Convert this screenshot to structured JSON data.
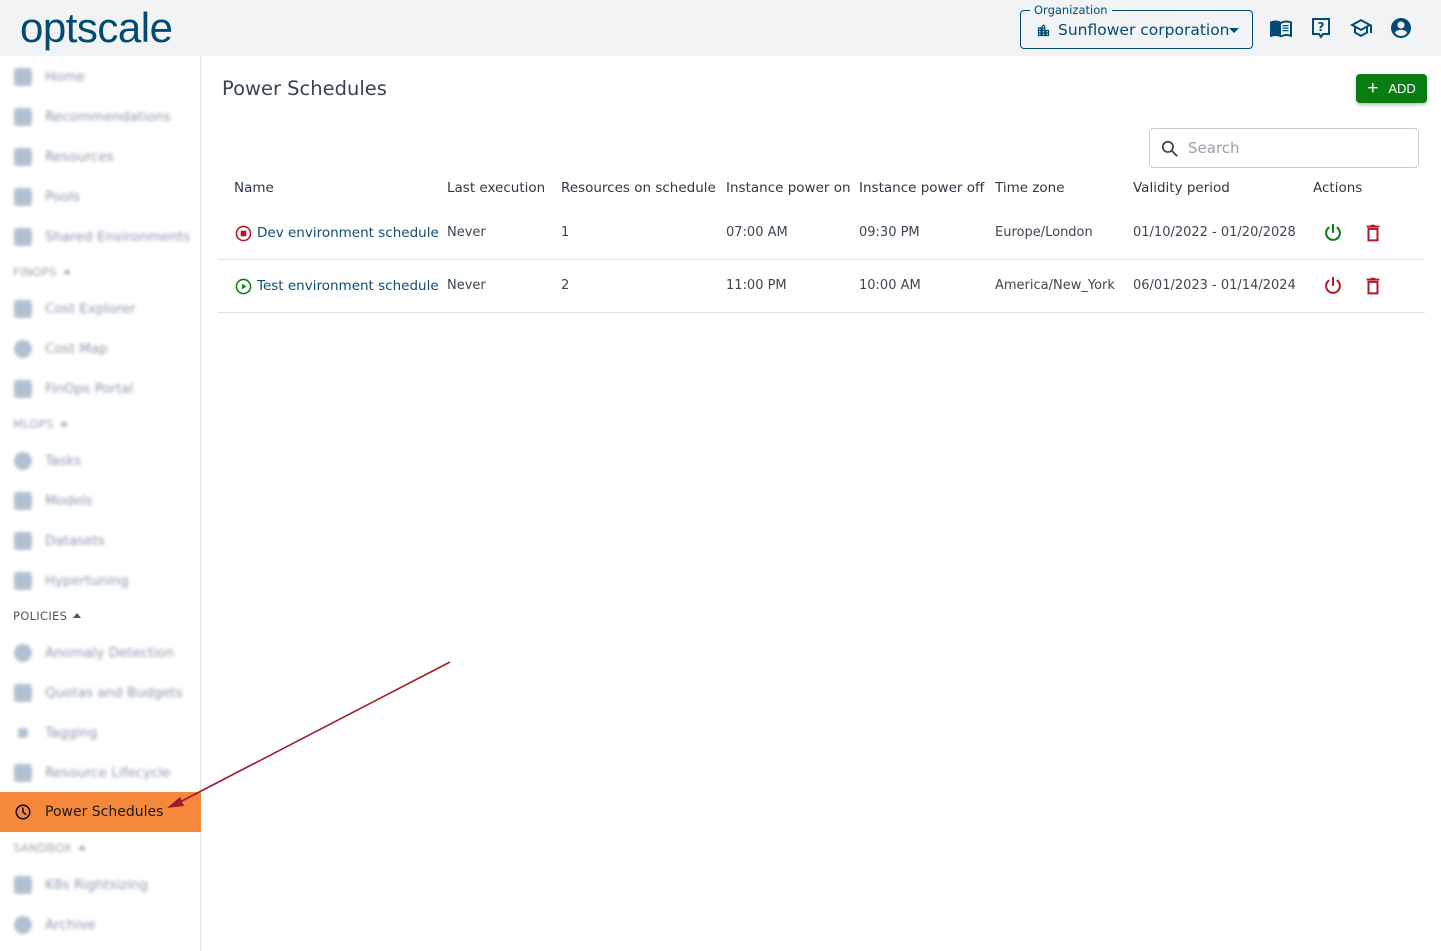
{
  "header": {
    "logo_text": "optscale",
    "organization": {
      "label": "Organization",
      "value": "Sunflower corporation",
      "icon": "building-icon"
    },
    "icons": [
      "documentation-book-icon",
      "help-icon",
      "academy-graduation-cap-icon",
      "account-circle-icon"
    ]
  },
  "sidebar": {
    "items": [
      {
        "label": "Home",
        "icon": "home-icon"
      },
      {
        "label": "Recommendations",
        "icon": "thumb-up-icon"
      },
      {
        "label": "Resources",
        "icon": "resources-icon"
      },
      {
        "label": "Pools",
        "icon": "pools-icon"
      },
      {
        "label": "Shared Environments",
        "icon": "environments-icon"
      }
    ],
    "finops": {
      "label": "FINOPS",
      "items": [
        {
          "label": "Cost Explorer",
          "icon": "chart-icon"
        },
        {
          "label": "Cost Map",
          "icon": "globe-icon"
        },
        {
          "label": "FinOps Portal",
          "icon": "phone-icon"
        }
      ]
    },
    "mlops": {
      "label": "MLOPS",
      "items": [
        {
          "label": "Tasks",
          "icon": "tasks-icon"
        },
        {
          "label": "Models",
          "icon": "star-icon"
        },
        {
          "label": "Datasets",
          "icon": "dataset-icon"
        },
        {
          "label": "Hypertuning",
          "icon": "hypertuning-icon"
        }
      ]
    },
    "policies": {
      "label": "POLICIES",
      "items": [
        {
          "label": "Anomaly Detection",
          "icon": "anomaly-icon"
        },
        {
          "label": "Quotas and Budgets",
          "icon": "budget-icon"
        },
        {
          "label": "Tagging",
          "icon": "tag-icon"
        },
        {
          "label": "Resource Lifecycle",
          "icon": "lifecycle-icon"
        },
        {
          "label": "Power Schedules",
          "icon": "clock-icon",
          "active": true
        }
      ]
    },
    "sandbox": {
      "label": "SANDBOX",
      "items": [
        {
          "label": "K8s Rightsizing",
          "icon": "k8s-icon"
        },
        {
          "label": "Archive",
          "icon": "archive-icon"
        }
      ]
    }
  },
  "main": {
    "title": "Power Schedules",
    "add_button_label": "ADD",
    "search": {
      "placeholder": "Search",
      "value": ""
    },
    "table": {
      "columns": [
        "Name",
        "Last execution",
        "Resources on schedule",
        "Instance power on",
        "Instance power off",
        "Time zone",
        "Validity period",
        "Actions"
      ],
      "rows": [
        {
          "status": "stopped",
          "status_color": "#b0182b",
          "name": "Dev environment schedule",
          "last_execution": "Never",
          "resources": "1",
          "power_on": "07:00 AM",
          "power_off": "09:30 PM",
          "time_zone": "Europe/London",
          "validity": "01/10/2022 - 01/20/2028",
          "power_action_color": "#0a7d12"
        },
        {
          "status": "running",
          "status_color": "#0a7d12",
          "name": "Test environment schedule",
          "last_execution": "Never",
          "resources": "2",
          "power_on": "11:00 PM",
          "power_off": "10:00 AM",
          "time_zone": "America/New_York",
          "validity": "06/01/2023 - 01/14/2024",
          "power_action_color": "#b0182b"
        }
      ]
    }
  },
  "colors": {
    "brand": "#004c74",
    "accent_active": "#f5883b",
    "success": "#0a7d12",
    "danger": "#b0182b",
    "annotation_arrow": "#a11a2a"
  }
}
